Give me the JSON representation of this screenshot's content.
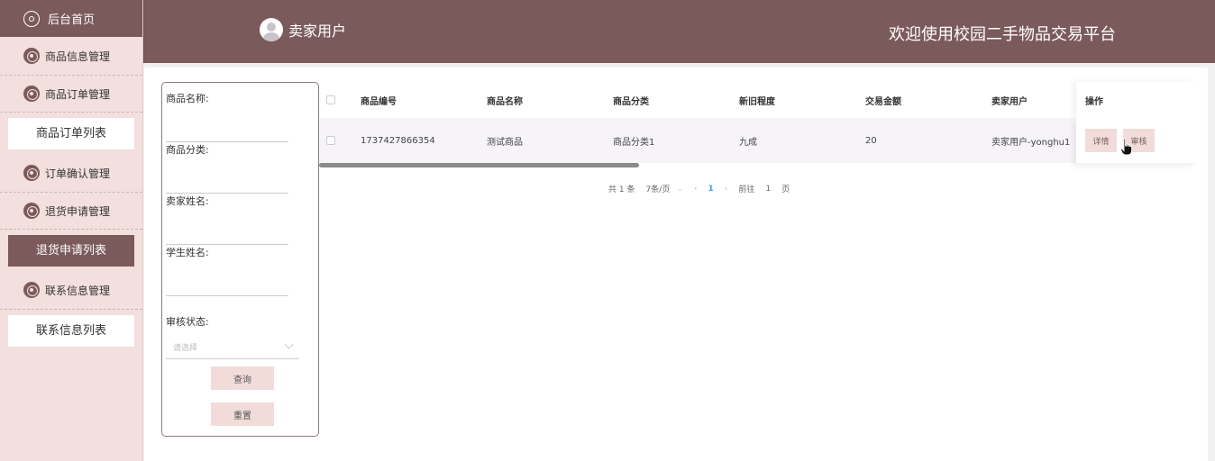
{
  "sidebar": {
    "home_label": "后台首页",
    "groups": [
      {
        "label": "商品信息管理"
      },
      {
        "label": "商品订单管理"
      },
      {
        "label": "订单确认管理"
      },
      {
        "label": "退货申请管理"
      },
      {
        "label": "联系信息管理"
      }
    ],
    "subs": [
      {
        "label": "商品订单列表",
        "active": false
      },
      {
        "label": "退货申请列表",
        "active": true
      },
      {
        "label": "联系信息列表",
        "active": false
      }
    ]
  },
  "header": {
    "user_label": "卖家用户",
    "welcome": "欢迎使用校园二手物品交易平台"
  },
  "search": {
    "product_name_label": "商品名称:",
    "category_label": "商品分类:",
    "seller_name_label": "卖家姓名:",
    "student_name_label": "学生姓名:",
    "audit_status_label": "审核状态:",
    "audit_placeholder": "请选择",
    "query_btn": "查询",
    "reset_btn": "重置"
  },
  "table": {
    "columns": [
      "商品编号",
      "商品名称",
      "商品分类",
      "新旧程度",
      "交易金额",
      "卖家用户",
      "操作"
    ],
    "rows": [
      {
        "product_no": "1737427866354",
        "product_name": "测试商品",
        "category": "商品分类1",
        "condition": "九成",
        "amount": "20",
        "seller": "卖家用户-yonghu1",
        "actions": [
          "详情",
          "审核"
        ]
      }
    ]
  },
  "pager": {
    "total": "共 1 条",
    "page_size": "7条/页",
    "prev": "‹",
    "current": "1",
    "next": "›",
    "goto_label": "前往",
    "goto_value": "1",
    "page_suffix": "页"
  },
  "colors": {
    "brand": "#7b5a5b",
    "sidebar_bg": "#f3dfdd",
    "button_pink": "#f1dcda"
  }
}
